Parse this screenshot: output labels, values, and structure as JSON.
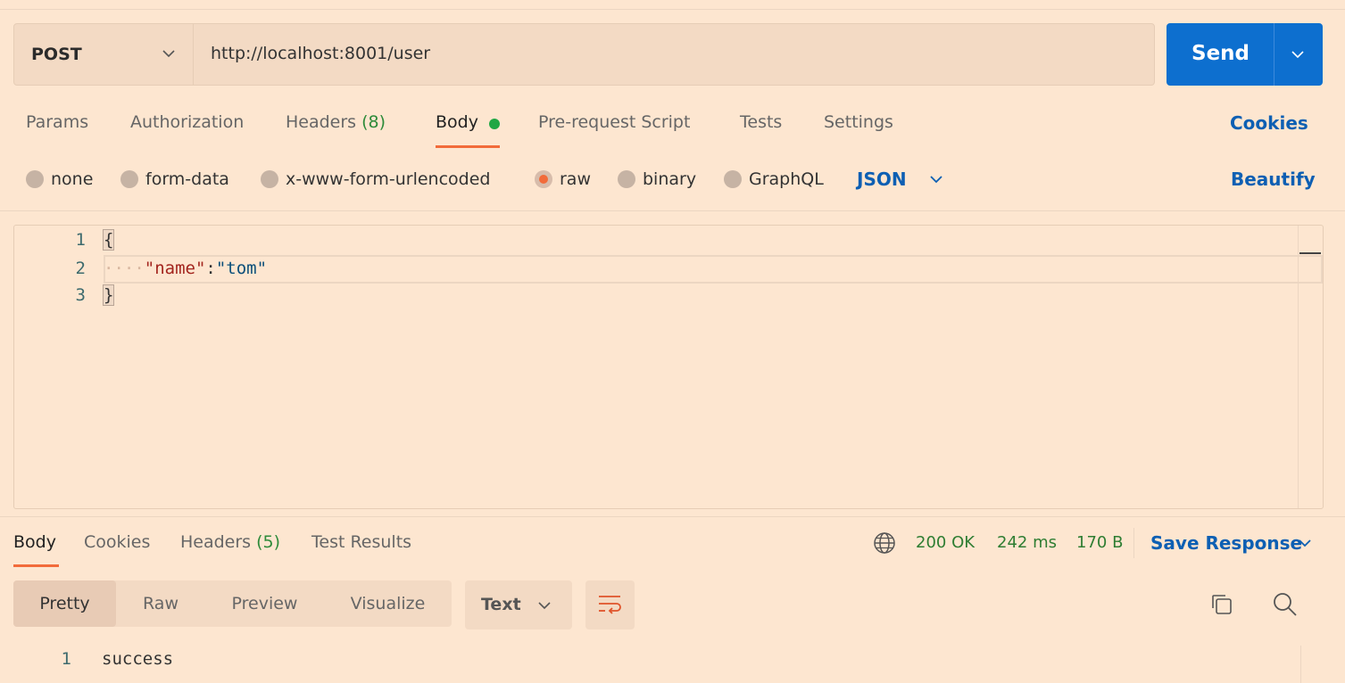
{
  "request": {
    "method": "POST",
    "url": "http://localhost:8001/user",
    "send_label": "Send"
  },
  "tabs": [
    {
      "label": "Params"
    },
    {
      "label": "Authorization"
    },
    {
      "label": "Headers",
      "count": "(8)"
    },
    {
      "label": "Body",
      "active": true
    },
    {
      "label": "Pre-request Script"
    },
    {
      "label": "Tests"
    },
    {
      "label": "Settings"
    }
  ],
  "cookies_label": "Cookies",
  "body_types": [
    "none",
    "form-data",
    "x-www-form-urlencoded",
    "raw",
    "binary",
    "GraphQL"
  ],
  "body_type_selected": "raw",
  "format_label": "JSON",
  "beautify_label": "Beautify",
  "editor": {
    "line_numbers": [
      "1",
      "2",
      "3"
    ],
    "open_brace": "{",
    "indent_dots": "····",
    "key": "\"name\"",
    "colon": ":",
    "value": "\"tom\"",
    "close_brace": "}"
  },
  "response": {
    "tabs": [
      {
        "label": "Body",
        "active": true
      },
      {
        "label": "Cookies"
      },
      {
        "label": "Headers",
        "count": "(5)"
      },
      {
        "label": "Test Results"
      }
    ],
    "status": "200 OK",
    "time": "242 ms",
    "size": "170 B",
    "save_label": "Save Response",
    "views": [
      "Pretty",
      "Raw",
      "Preview",
      "Visualize"
    ],
    "view_selected": "Pretty",
    "format": "Text",
    "line_number": "1",
    "body": "success"
  },
  "colors": {
    "background": "#fde6d0",
    "accent": "#f26b3a",
    "send_button": "#0d6fcf",
    "link": "#0d5fb3",
    "status_ok": "#2e7d32"
  },
  "icons": [
    "chevron-down-icon",
    "globe-icon",
    "wrap-lines-icon",
    "copy-icon",
    "search-icon"
  ]
}
